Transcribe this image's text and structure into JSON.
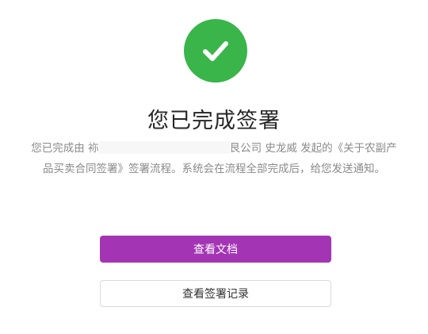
{
  "status": {
    "icon": "checkmark-icon",
    "color": "#39b54a",
    "title": "您已完成签署"
  },
  "message": {
    "part1": "您已完成由",
    "part1_tail": "袮",
    "part2": "艮公司 史龙威 发起的《关于农副产品买卖合同签署》签署流程。系统会在流程全部完成后，给您发送通知。"
  },
  "actions": {
    "view_document_label": "查看文档",
    "view_document_color": "#a335b5",
    "view_record_label": "查看签署记录"
  }
}
